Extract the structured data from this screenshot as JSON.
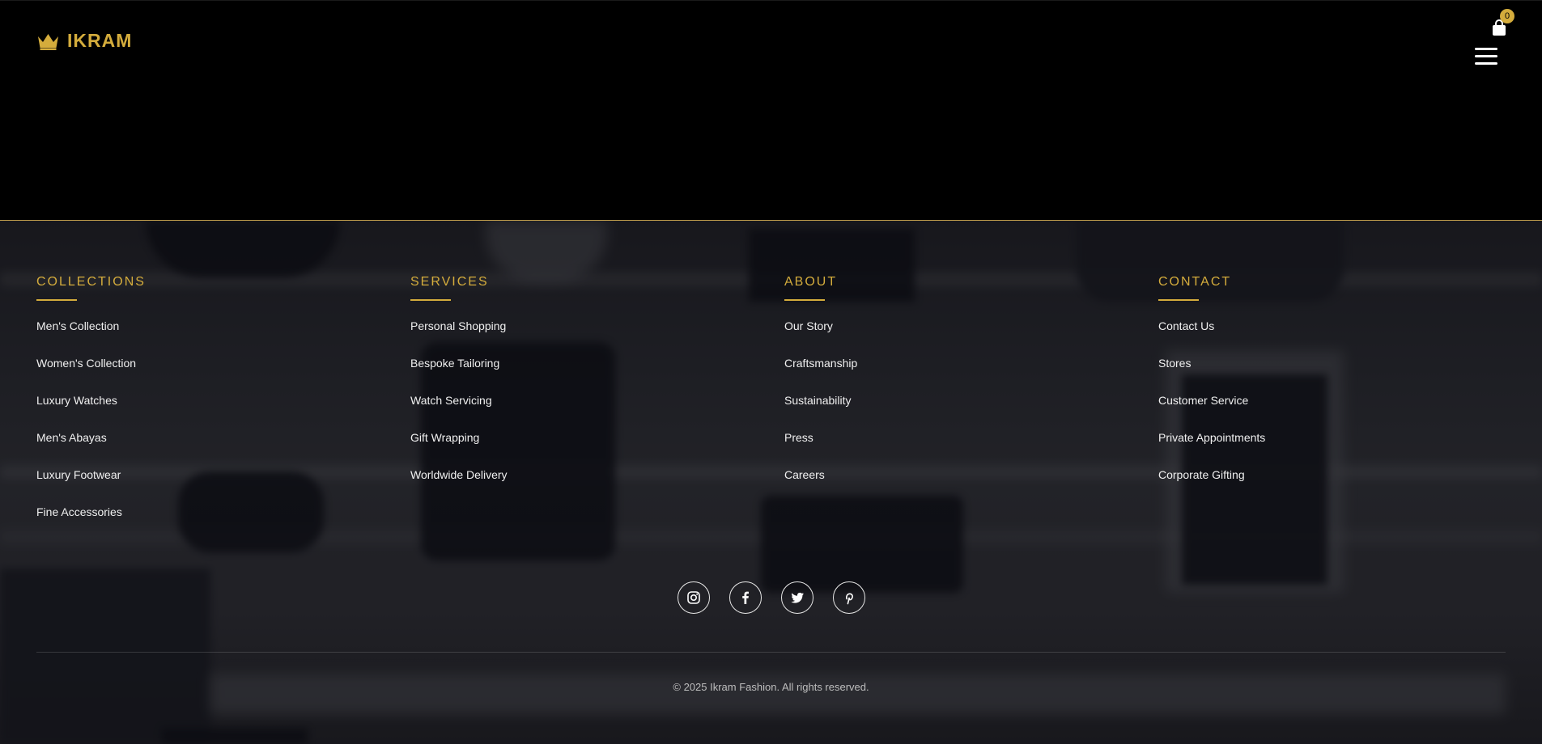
{
  "header": {
    "logo_text": "IKRAM",
    "logo_icon": "crown-icon",
    "cart_icon": "shopping-bag-icon",
    "cart_count": "0",
    "menu_icon": "hamburger-menu-icon"
  },
  "footer": {
    "columns": [
      {
        "title": "COLLECTIONS",
        "links": [
          "Men's Collection",
          "Women's Collection",
          "Luxury Watches",
          "Men's Abayas",
          "Luxury Footwear",
          "Fine Accessories"
        ]
      },
      {
        "title": "SERVICES",
        "links": [
          "Personal Shopping",
          "Bespoke Tailoring",
          "Watch Servicing",
          "Gift Wrapping",
          "Worldwide Delivery"
        ]
      },
      {
        "title": "ABOUT",
        "links": [
          "Our Story",
          "Craftsmanship",
          "Sustainability",
          "Press",
          "Careers"
        ]
      },
      {
        "title": "CONTACT",
        "links": [
          "Contact Us",
          "Stores",
          "Customer Service",
          "Private Appointments",
          "Corporate Gifting"
        ]
      }
    ],
    "socials": [
      "instagram-icon",
      "facebook-icon",
      "twitter-icon",
      "pinterest-icon"
    ],
    "copyright": "© 2025 Ikram Fashion. All rights reserved."
  },
  "colors": {
    "accent": "#d4ac3c",
    "header_bg": "#000000",
    "link_text": "#f0f0f0"
  }
}
